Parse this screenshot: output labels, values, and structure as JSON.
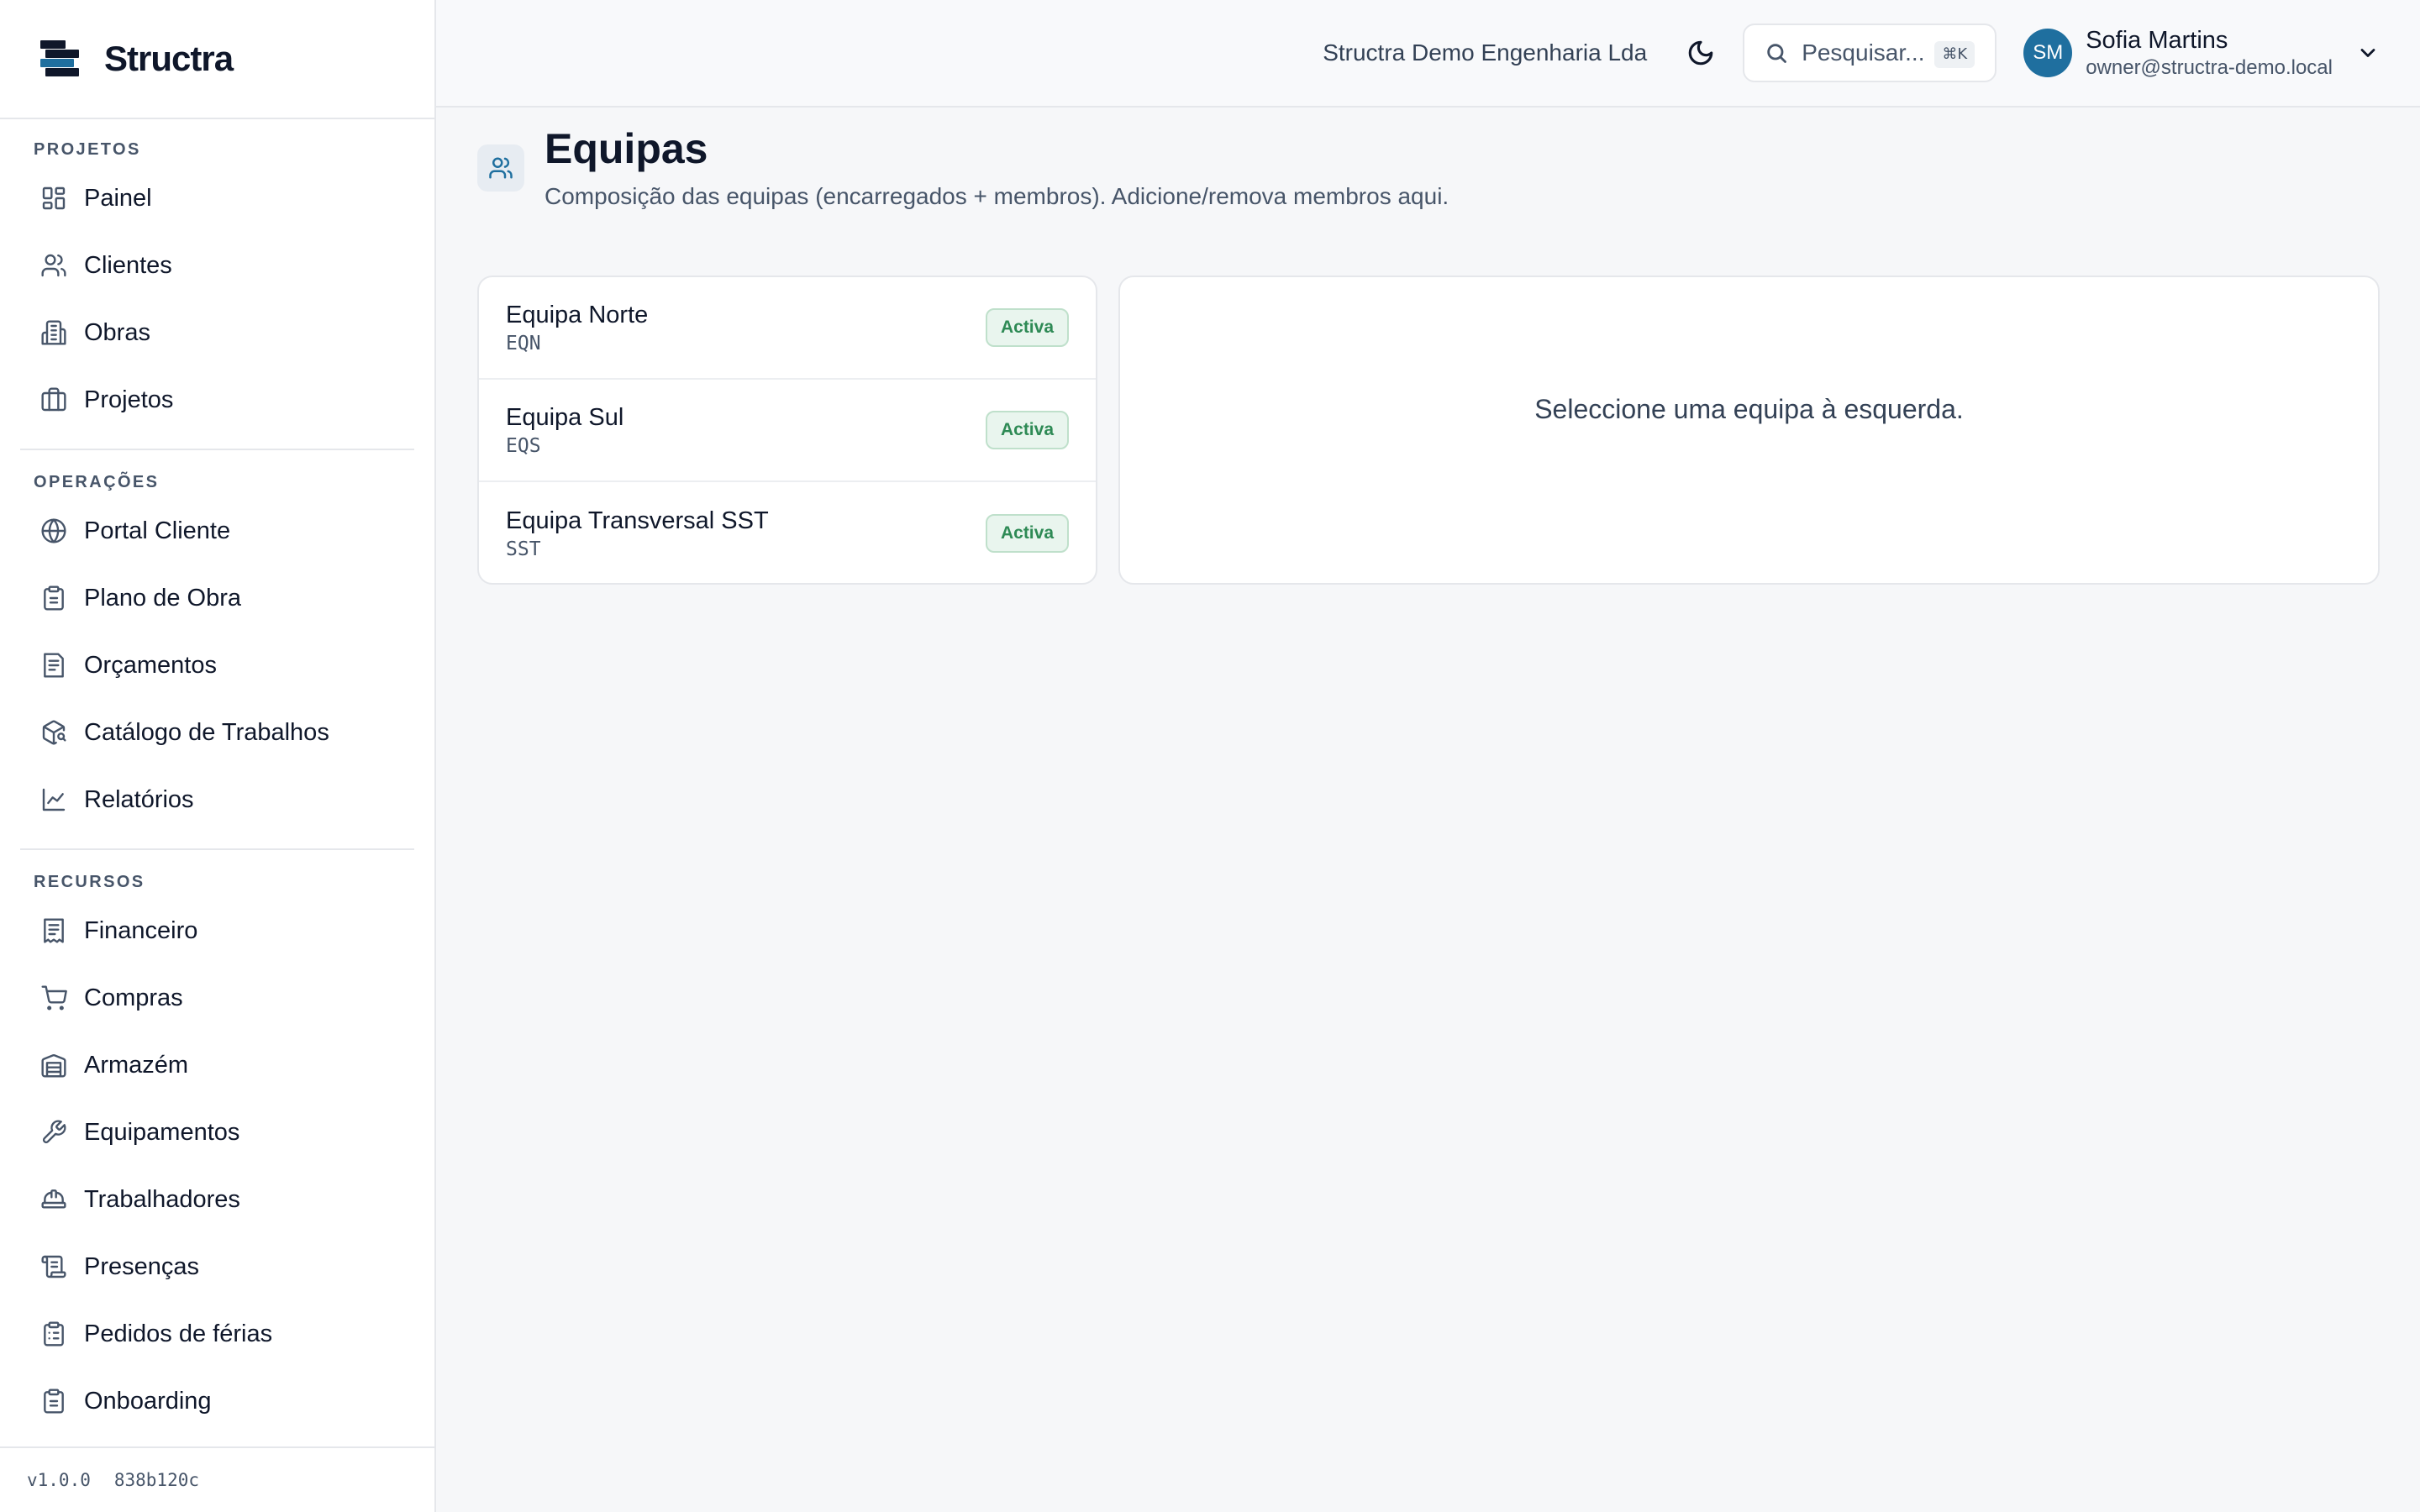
{
  "app": {
    "name": "Structra",
    "version": "v1.0.0",
    "build": "838b120c"
  },
  "colors": {
    "accent": "#1f6f9f",
    "success": "#2e8a55",
    "logo_dark": "#0f172a",
    "logo_blue": "#1f6f9f"
  },
  "sidebar": {
    "groups": [
      {
        "title": "PROJETOS",
        "items": [
          {
            "label": "Painel",
            "icon": "dashboard-icon"
          },
          {
            "label": "Clientes",
            "icon": "users-icon"
          },
          {
            "label": "Obras",
            "icon": "building-icon"
          },
          {
            "label": "Projetos",
            "icon": "briefcase-icon"
          }
        ]
      },
      {
        "title": "OPERAÇÕES",
        "items": [
          {
            "label": "Portal Cliente",
            "icon": "globe-icon"
          },
          {
            "label": "Plano de Obra",
            "icon": "clipboard-icon"
          },
          {
            "label": "Orçamentos",
            "icon": "document-icon"
          },
          {
            "label": "Catálogo de Trabalhos",
            "icon": "package-search-icon"
          },
          {
            "label": "Relatórios",
            "icon": "line-chart-icon"
          }
        ]
      },
      {
        "title": "RECURSOS",
        "items": [
          {
            "label": "Financeiro",
            "icon": "receipt-icon"
          },
          {
            "label": "Compras",
            "icon": "cart-icon"
          },
          {
            "label": "Armazém",
            "icon": "warehouse-icon"
          },
          {
            "label": "Equipamentos",
            "icon": "wrench-icon"
          },
          {
            "label": "Trabalhadores",
            "icon": "hard-hat-icon"
          },
          {
            "label": "Presenças",
            "icon": "scroll-icon"
          },
          {
            "label": "Pedidos de férias",
            "icon": "clipboard-list-icon"
          },
          {
            "label": "Onboarding",
            "icon": "clipboard-check-icon"
          }
        ]
      }
    ]
  },
  "topbar": {
    "company": "Structra Demo Engenharia Lda",
    "search_placeholder": "Pesquisar...",
    "search_shortcut": "⌘K",
    "user": {
      "initials": "SM",
      "name": "Sofia Martins",
      "email": "owner@structra-demo.local"
    }
  },
  "page": {
    "title": "Equipas",
    "subtitle": "Composição das equipas (encarregados + membros). Adicione/remova membros aqui."
  },
  "teams": [
    {
      "name": "Equipa Norte",
      "code": "EQN",
      "status": "Activa"
    },
    {
      "name": "Equipa Sul",
      "code": "EQS",
      "status": "Activa"
    },
    {
      "name": "Equipa Transversal SST",
      "code": "SST",
      "status": "Activa"
    }
  ],
  "detail": {
    "empty_message": "Seleccione uma equipa à esquerda."
  }
}
